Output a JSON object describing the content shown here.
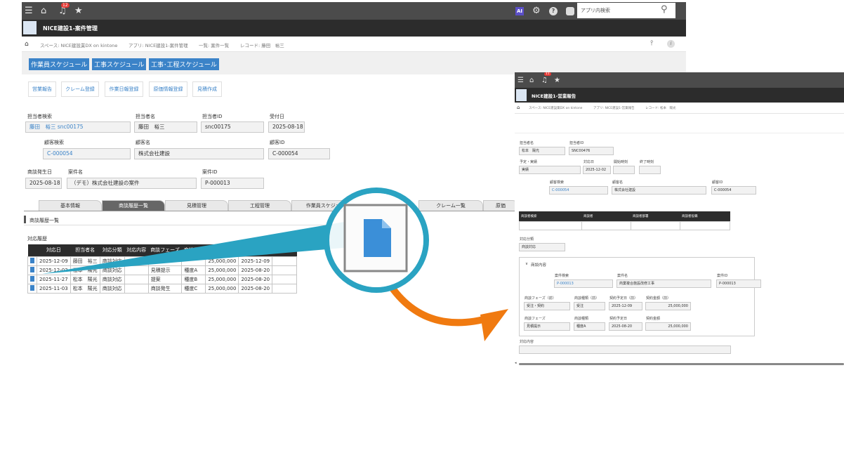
{
  "main": {
    "notification_count": "12",
    "ai_label": "AI",
    "search_placeholder": "アプリ内検索",
    "app_title": "NICE建設1-案件管理",
    "breadcrumb": [
      "スペース: NICE建設業DX on kintone",
      "アプリ: NICE建設1-案件管理",
      "一覧: 案件一覧",
      "レコード: 藤田　裕三"
    ],
    "schedule_tags": [
      "作業員スケジュール",
      "工事スケジュール",
      "工事･工程スケジュール"
    ],
    "action_buttons": [
      "営業報告",
      "クレーム登録",
      "作業日報登録",
      "原価情報登録",
      "見積作成"
    ],
    "fields": {
      "tantou_search": {
        "label": "担当者検索",
        "value": "藤田　裕三 snc00175"
      },
      "tantou_name": {
        "label": "担当者名",
        "value": "藤田　裕三"
      },
      "tantou_id": {
        "label": "担当者ID",
        "value": "snc00175"
      },
      "uketsuke": {
        "label": "受付日",
        "value": "2025-08-18"
      },
      "kokyaku_search": {
        "label": "顧客検索",
        "value": "C-000054"
      },
      "kokyaku_name": {
        "label": "顧客名",
        "value": "株式会社建設"
      },
      "kokyaku_id": {
        "label": "顧客ID",
        "value": "C-000054"
      },
      "shodan_date": {
        "label": "商談発生日",
        "value": "2025-08-18"
      },
      "anken_name": {
        "label": "案件名",
        "value": "（デモ）株式会社建設の案件"
      },
      "anken_id": {
        "label": "案件ID",
        "value": "P-000013"
      }
    },
    "tabs": [
      "基本情報",
      "商談履歴一覧",
      "見積管理",
      "工程管理",
      "作業員スケジュ",
      "クレーム一覧",
      "原価"
    ],
    "section_title": "商談履歴一覧",
    "table_label": "対応履歴",
    "table_headers": [
      "対応日",
      "担当者名",
      "対応分類",
      "対応内容",
      "商談フェーズ",
      "商談種類",
      "",
      ""
    ],
    "table_rows": [
      [
        "2025-12-09",
        "藤田　裕三",
        "商談対応",
        "",
        "",
        "",
        "25,000,000",
        "2025-12-09"
      ],
      [
        "2025-12-02",
        "松本　陽光",
        "商談対応",
        "",
        "見積提示",
        "種度A",
        "25,000,000",
        "2025-08-20"
      ],
      [
        "2025-11-27",
        "松本　陽光",
        "商談対応",
        "",
        "提案",
        "種度B",
        "25,000,000",
        "2025-08-20"
      ],
      [
        "2025-11-03",
        "松本　陽光",
        "商談対応",
        "",
        "商談発生",
        "種度C",
        "25,000,000",
        "2025-08-20"
      ]
    ]
  },
  "right": {
    "notification_count": "11",
    "app_title": "NICE建設1-営業報告",
    "breadcrumb": [
      "スペース: NICE建設業DX on kintone",
      "アプリ: NICE建設1-営業報告",
      "レコード: 松本　陽光"
    ],
    "tantou_name": {
      "label": "担当者名",
      "value": "松本　陽光"
    },
    "tantou_id": {
      "label": "担当者ID",
      "value": "SNC00476"
    },
    "yotei": {
      "label": "予定・実績",
      "value": "実績"
    },
    "taiou_date": {
      "label": "対応日",
      "value": "2025-12-02"
    },
    "start_time": {
      "label": "開始時刻",
      "value": ""
    },
    "end_time": {
      "label": "終了時刻",
      "value": ""
    },
    "kokyaku_search": {
      "label": "顧客検索",
      "value": "C-000054"
    },
    "kokyaku_name": {
      "label": "顧客名",
      "value": "株式会社建設"
    },
    "kokyaku_id": {
      "label": "顧客ID",
      "value": "C-000054"
    },
    "table_headers": [
      "商談者検索",
      "商談者",
      "商談者部署",
      "商談者役職"
    ],
    "taiou_bunrui": {
      "label": "対応分類",
      "value": "商談対応"
    },
    "group_title": "商談内容",
    "anken_search": {
      "label": "案件検索",
      "value": "P-000013"
    },
    "anken_name": {
      "label": "案件名",
      "value": "商業複合施設改修工事"
    },
    "anken_id": {
      "label": "案件ID",
      "value": "P-000013"
    },
    "phase_before": {
      "label": "商談フェーズ（前）",
      "value": "受注・契約"
    },
    "kind_before": {
      "label": "商談種類（前）",
      "value": "受注"
    },
    "contract_date_before": {
      "label": "契約予定日（前）",
      "value": "2025-12-09"
    },
    "contract_amount_before": {
      "label": "契約金額（前）",
      "value": "25,000,000"
    },
    "phase": {
      "label": "商談フェーズ",
      "value": "見積提示"
    },
    "kind": {
      "label": "商談種類",
      "value": "種度A"
    },
    "contract_date": {
      "label": "契約予定日",
      "value": "2025-08-20"
    },
    "contract_amount": {
      "label": "契約金額",
      "value": "25,000,000"
    },
    "taiou_naiyou": {
      "label": "対応内容",
      "value": ""
    }
  },
  "colors": {
    "accent": "#3b83c8",
    "circle": "#2aa3c2",
    "arrow": "#f07a10",
    "dark": "#2c2c2c"
  }
}
